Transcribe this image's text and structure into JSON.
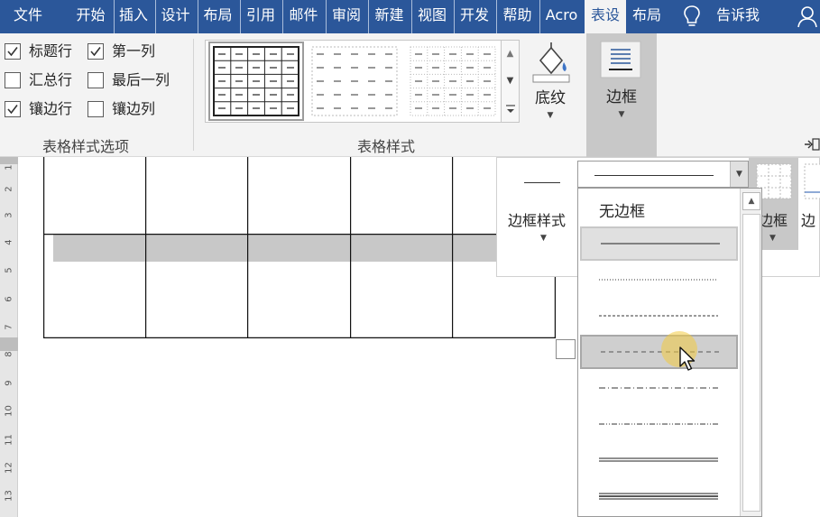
{
  "tabs": [
    {
      "label": "文件",
      "active": false
    },
    {
      "label": "开始",
      "active": false
    },
    {
      "label": "插入",
      "active": false
    },
    {
      "label": "设计",
      "active": false
    },
    {
      "label": "布局",
      "active": false
    },
    {
      "label": "引用",
      "active": false
    },
    {
      "label": "邮件",
      "active": false
    },
    {
      "label": "审阅",
      "active": false
    },
    {
      "label": "新建",
      "active": false
    },
    {
      "label": "视图",
      "active": false
    },
    {
      "label": "开发",
      "active": false
    },
    {
      "label": "帮助",
      "active": false
    },
    {
      "label": "Acro",
      "active": false
    },
    {
      "label": "表设",
      "active": true
    },
    {
      "label": "布局",
      "active": false
    }
  ],
  "tell_me": {
    "label": "告诉我",
    "icon": "lightbulb-icon"
  },
  "account_icon": "person-icon",
  "ribbon": {
    "style_options": {
      "group_label": "表格样式选项",
      "checkboxes": [
        {
          "label": "标题行",
          "checked": true
        },
        {
          "label": "第一列",
          "checked": true
        },
        {
          "label": "汇总行",
          "checked": false
        },
        {
          "label": "最后一列",
          "checked": false
        },
        {
          "label": "镶边行",
          "checked": true
        },
        {
          "label": "镶边列",
          "checked": false
        }
      ]
    },
    "table_styles": {
      "group_label": "表格样式"
    },
    "shading": {
      "label": "底纹",
      "icon": "paint-bucket-icon"
    },
    "borders": {
      "label": "边框",
      "icon": "borders-icon"
    }
  },
  "border_panel": {
    "style_label": "边框样式",
    "right_label": "边框",
    "right_label_cut": "边"
  },
  "dropdown": {
    "items": [
      {
        "label": "无边框",
        "kind": "none"
      },
      {
        "label": "",
        "kind": "solid"
      },
      {
        "label": "",
        "kind": "dotted"
      },
      {
        "label": "",
        "kind": "dashed-fine"
      },
      {
        "label": "",
        "kind": "dashed"
      },
      {
        "label": "",
        "kind": "dash-dot"
      },
      {
        "label": "",
        "kind": "dash-dot-dot"
      },
      {
        "label": "",
        "kind": "double"
      },
      {
        "label": "",
        "kind": "thick-thin"
      }
    ],
    "selected_index": 1,
    "hover_index": 4
  },
  "ruler": {
    "numbers": [
      "1",
      "2",
      "3",
      "4",
      "5",
      "6",
      "7",
      "8",
      "9",
      "10",
      "11",
      "12",
      "13"
    ]
  },
  "colors": {
    "title_bar": "#2b579a",
    "ribbon": "#f3f3f3",
    "highlight": "#c8c8c8",
    "cursor_glow": "#f2ca40"
  }
}
